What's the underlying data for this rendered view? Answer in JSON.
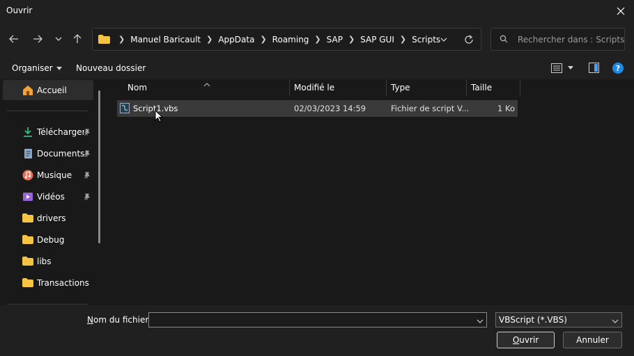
{
  "window": {
    "title": "Ouvrir"
  },
  "address": {
    "crumbs": [
      "Manuel Baricault",
      "AppData",
      "Roaming",
      "SAP",
      "SAP GUI",
      "Scripts"
    ]
  },
  "search": {
    "placeholder": "Rechercher dans : Scripts"
  },
  "commands": {
    "organize": "Organiser",
    "new_folder": "Nouveau dossier"
  },
  "sidebar": {
    "home": "Accueil",
    "items": [
      {
        "label": "Téléchargem",
        "icon": "download-icon",
        "pinned": true
      },
      {
        "label": "Documents",
        "icon": "documents-icon",
        "pinned": true
      },
      {
        "label": "Musique",
        "icon": "music-icon",
        "pinned": true
      },
      {
        "label": "Vidéos",
        "icon": "videos-icon",
        "pinned": true
      },
      {
        "label": "drivers",
        "icon": "folder-icon",
        "pinned": false
      },
      {
        "label": "Debug",
        "icon": "folder-icon",
        "pinned": false
      },
      {
        "label": "libs",
        "icon": "folder-icon",
        "pinned": false
      },
      {
        "label": "Transactions",
        "icon": "folder-icon",
        "pinned": false
      }
    ]
  },
  "columns": {
    "name": "Nom",
    "modified": "Modifié le",
    "type": "Type",
    "size": "Taille"
  },
  "files": [
    {
      "name": "Script1.vbs",
      "modified": "02/03/2023 14:59",
      "type": "Fichier de script V...",
      "size": "1 Ko"
    }
  ],
  "bottom": {
    "filename_label_first": "N",
    "filename_label_rest": "om du fichier :",
    "filename_value": "",
    "filetype": "VBScript (*.VBS)",
    "open_first": "O",
    "open_rest": "uvrir",
    "cancel": "Annuler"
  },
  "colors": {
    "background": "#202020",
    "pane": "#191919",
    "selection": "#3a3a3a",
    "folder": "#f6c342",
    "help": "#1e88e5"
  }
}
